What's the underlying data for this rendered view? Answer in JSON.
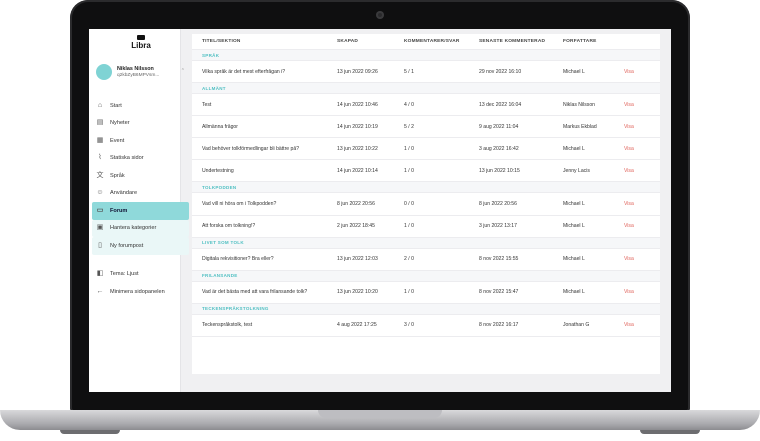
{
  "app": {
    "logo": "Libra"
  },
  "user": {
    "name": "Niklas Nilsson",
    "id": "q2kbZyB6MPVsm..."
  },
  "nav": [
    {
      "label": "Start",
      "icon": "home-icon"
    },
    {
      "label": "Nyheter",
      "icon": "newspaper-icon"
    },
    {
      "label": "Event",
      "icon": "calendar-icon"
    },
    {
      "label": "Statiska sidor",
      "icon": "paperclip-icon"
    },
    {
      "label": "Språk",
      "icon": "translate-icon"
    },
    {
      "label": "Användare",
      "icon": "users-icon"
    },
    {
      "label": "Forum",
      "icon": "forum-icon"
    },
    {
      "label": "Hantera kategorier",
      "icon": "category-icon"
    },
    {
      "label": "Ny forumpost",
      "icon": "new-post-icon"
    }
  ],
  "nav_bottom": [
    {
      "label": "Tema: Ljust",
      "icon": "theme-icon"
    },
    {
      "label": "Minimera sidopanelen",
      "icon": "arrow-left-icon"
    }
  ],
  "table": {
    "headers": [
      "TITEL/SEKTION",
      "SKAPAD",
      "KOMMENTARER/SVAR",
      "SENASTE KOMMENTERAD",
      "FÖRFATTARE"
    ],
    "action_label": "Visa",
    "sections": [
      {
        "name": "SPRÅK",
        "rows": [
          [
            "Vilka språk är det mest efterfrågan i?",
            "13 jun 2022 09:26",
            "5 / 1",
            "29 nov 2022 16:10",
            "Michael L"
          ]
        ]
      },
      {
        "name": "ALLMÄNT",
        "rows": [
          [
            "Test",
            "14 jun 2022 10:46",
            "4 / 0",
            "13 dec 2022 16:04",
            "Niklas Nilsson"
          ],
          [
            "Allmänna frågor",
            "14 jun 2022 10:19",
            "5 / 2",
            "9 aug 2022 11:04",
            "Markus Ekblad"
          ],
          [
            "Vad behöver tolkförmedlingar bli bättre på?",
            "13 jun 2022 10:22",
            "1 / 0",
            "3 aug 2022 16:42",
            "Michael L"
          ],
          [
            "Undertestning",
            "14 jun 2022 10:14",
            "1 / 0",
            "13 jun 2022 10:15",
            "Jenny Lacis"
          ]
        ]
      },
      {
        "name": "TOLKPODDEN",
        "rows": [
          [
            "Vad vill ni höra om i Tolkpodden?",
            "8 jun 2022 20:56",
            "0 / 0",
            "8 jun 2022 20:56",
            "Michael L"
          ],
          [
            "Att forska om tolkning!?",
            "2 jun 2022 18:45",
            "1 / 0",
            "3 jun 2022 13:17",
            "Michael L"
          ]
        ]
      },
      {
        "name": "LIVET SOM TOLK",
        "rows": [
          [
            "Digitala rekvisitioner? Bra eller?",
            "13 jun 2022 12:03",
            "2 / 0",
            "8 nov 2022 15:55",
            "Michael L"
          ]
        ]
      },
      {
        "name": "FRILANSANDE",
        "rows": [
          [
            "Vad är det bästa med att vara frilansande tolk?",
            "13 jun 2022 10:20",
            "1 / 0",
            "8 nov 2022 15:47",
            "Michael L"
          ]
        ]
      },
      {
        "name": "TECKENSPRÅKSTOLKNING",
        "rows": [
          [
            "Teckenspråkstolk, test",
            "4 aug 2022 17:25",
            "3 / 0",
            "8 nov 2022 16:17",
            "Jonathan G"
          ]
        ]
      }
    ]
  }
}
